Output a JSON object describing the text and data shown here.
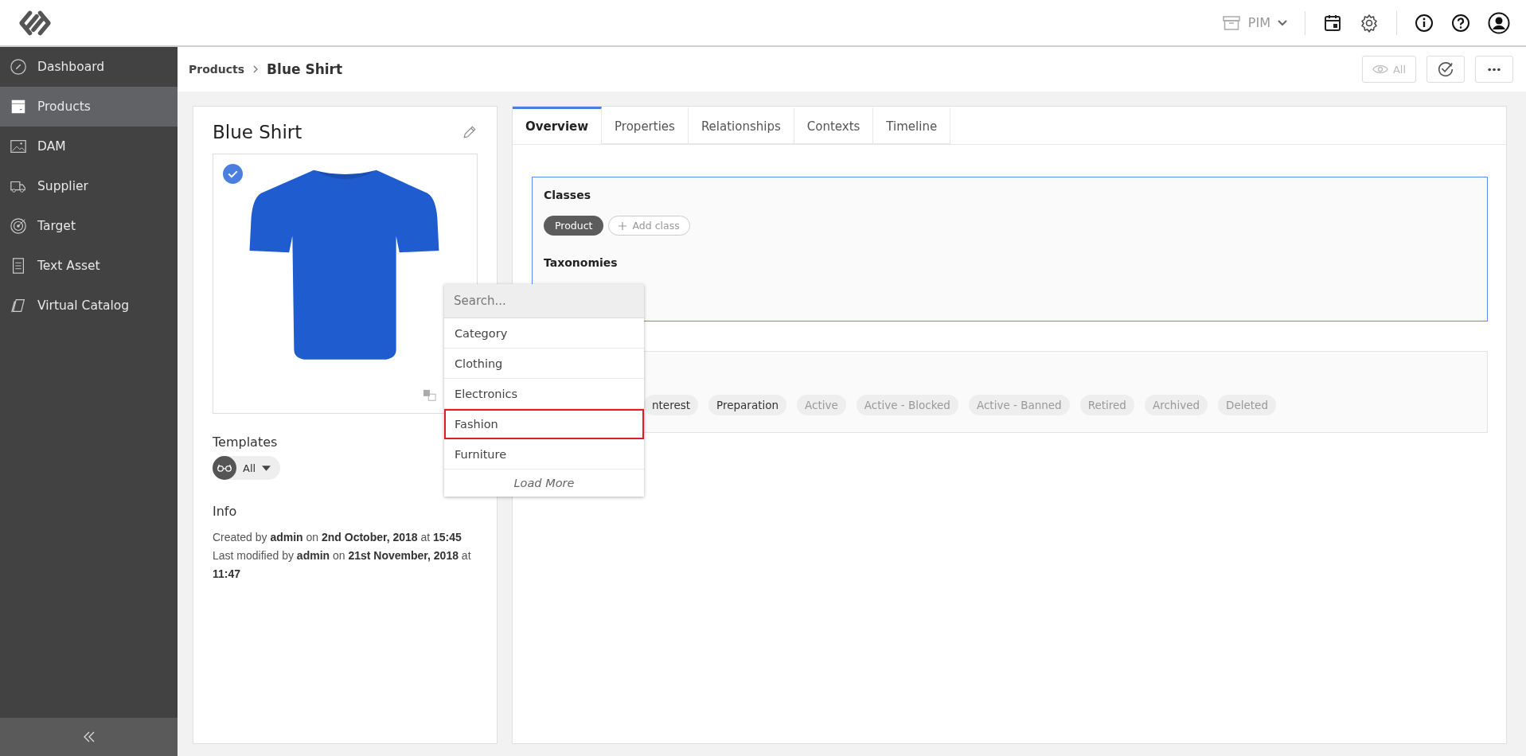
{
  "topbar": {
    "module": "PIM"
  },
  "sidebar": {
    "items": [
      {
        "label": "Dashboard",
        "selected": false
      },
      {
        "label": "Products",
        "selected": true
      },
      {
        "label": "DAM",
        "selected": false
      },
      {
        "label": "Supplier",
        "selected": false
      },
      {
        "label": "Target",
        "selected": false
      },
      {
        "label": "Text Asset",
        "selected": false
      },
      {
        "label": "Virtual Catalog",
        "selected": false
      }
    ]
  },
  "breadcrumb": {
    "parent": "Products",
    "current": "Blue Shirt"
  },
  "view_filter": "All",
  "product": {
    "title": "Blue Shirt",
    "image_selected": true,
    "templates_label": "Templates",
    "template": "All",
    "info_label": "Info",
    "info": [
      "Created by **admin** on **2nd October, 2018** at **15:45**",
      "Last modified by **admin** on **21st November, 2018** at **11:47**"
    ]
  },
  "tabs": [
    {
      "label": "Overview",
      "selected": true
    },
    {
      "label": "Properties",
      "selected": false
    },
    {
      "label": "Relationships",
      "selected": false
    },
    {
      "label": "Contexts",
      "selected": false
    },
    {
      "label": "Timeline",
      "selected": false
    }
  ],
  "classes": {
    "title": "Classes",
    "items": [
      "Product"
    ],
    "add_label": "Add class"
  },
  "taxonomies": {
    "title": "Taxonomies"
  },
  "lifecycle": {
    "states": [
      {
        "label": "nterest",
        "disabled": false
      },
      {
        "label": "Preparation",
        "disabled": false
      },
      {
        "label": "Active",
        "disabled": true
      },
      {
        "label": "Active - Blocked",
        "disabled": true
      },
      {
        "label": "Active - Banned",
        "disabled": true
      },
      {
        "label": "Retired",
        "disabled": true
      },
      {
        "label": "Archived",
        "disabled": true
      },
      {
        "label": "Deleted",
        "disabled": true
      }
    ]
  },
  "taxonomy_dropdown": {
    "placeholder": "Search...",
    "items": [
      {
        "label": "Category",
        "selected": false
      },
      {
        "label": "Clothing",
        "selected": false
      },
      {
        "label": "Electronics",
        "selected": false
      },
      {
        "label": "Fashion",
        "selected": true
      },
      {
        "label": "Furniture",
        "selected": false
      }
    ],
    "load_more": "Load More"
  }
}
